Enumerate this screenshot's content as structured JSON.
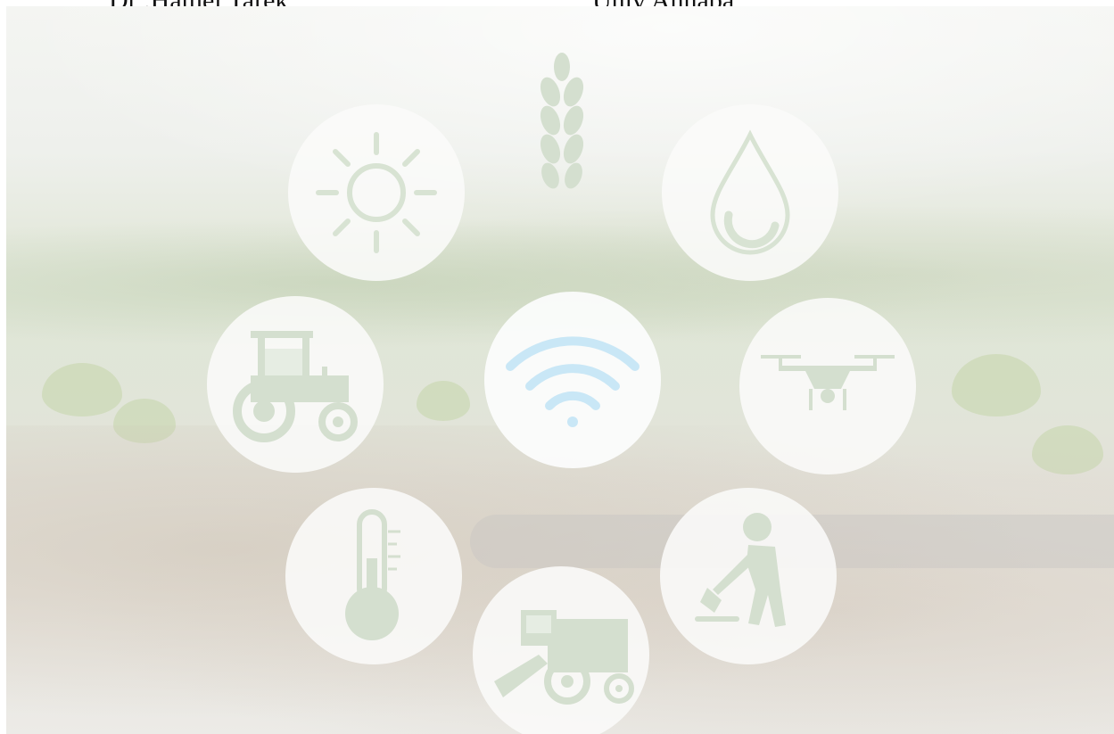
{
  "header": {
    "author": "Dr .Hamel Tarek",
    "affiliation": "Univ Annaba"
  },
  "icons": [
    "wheat-icon",
    "sun-icon",
    "water-drop-icon",
    "tractor-icon",
    "wifi-icon",
    "drone-icon",
    "thermometer-icon",
    "farmer-shovel-icon",
    "harvester-icon"
  ],
  "colors": {
    "icon_green": "#cfdccb",
    "wifi_blue": "#c6e6f5",
    "circle_fill": "#fafbf9"
  }
}
